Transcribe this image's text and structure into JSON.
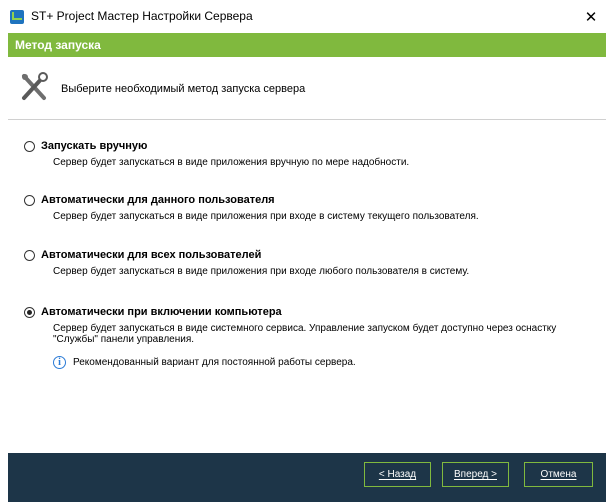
{
  "window": {
    "title": "ST+ Project Мастер Настройки Сервера",
    "close_symbol": "✕"
  },
  "header": {
    "title": "Метод запуска",
    "color": "#80b93e"
  },
  "instruction": {
    "icon": "tools-icon",
    "text": "Выберите необходимый метод запуска сервера"
  },
  "options": [
    {
      "label": "Запускать вручную",
      "description": "Сервер будет запускаться в виде приложения вручную по мере надобности.",
      "selected": false
    },
    {
      "label": "Автоматически для данного пользователя",
      "description": "Сервер будет запускаться в виде приложения при входе  в систему текущего пользователя.",
      "selected": false
    },
    {
      "label": "Автоматически для всех пользователей",
      "description": "Сервер будет запускаться в виде приложения при входе любого пользователя в систему.",
      "selected": false
    },
    {
      "label": "Автоматически при включении компьютера",
      "description": "Сервер будет запускаться в виде системного сервиса. Управление запуском будет доступно через оснастку \"Службы\" панели управления.",
      "selected": true,
      "info": "Рекомендованный вариант для постоянной работы сервера."
    }
  ],
  "footer": {
    "back_label": "< Назад",
    "next_label": "Вперед >",
    "cancel_label": "Отмена",
    "background": "#1d3548"
  }
}
